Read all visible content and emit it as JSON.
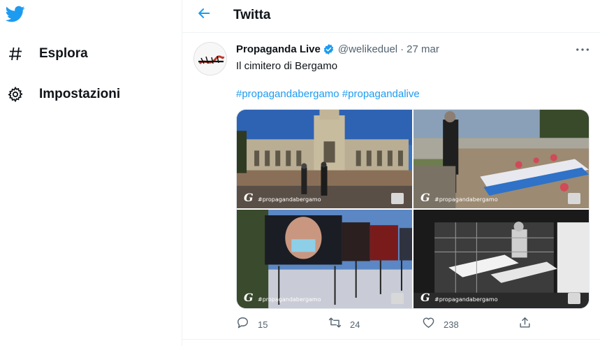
{
  "colors": {
    "accent": "#1d9bf0",
    "text": "#0f1419",
    "muted": "#536471",
    "border": "#eff3f4"
  },
  "sidebar": {
    "logo_icon": "twitter-bird-icon",
    "items": [
      {
        "label": "Esplora",
        "icon": "hashtag-icon"
      },
      {
        "label": "Impostazioni",
        "icon": "gear-icon"
      }
    ]
  },
  "header": {
    "title": "Twitta",
    "back_icon": "arrow-left-icon"
  },
  "tweet": {
    "author": "Propaganda Live",
    "verified": true,
    "handle": "@welikeduel",
    "separator": "·",
    "date": "27 mar",
    "text": "Il cimitero di Bergamo",
    "hashtags": [
      "#propagandabergamo",
      "#propagandalive"
    ],
    "media": [
      {
        "tag": "#propagandabergamo"
      },
      {
        "tag": "#propagandabergamo"
      },
      {
        "tag": "#propagandabergamo"
      },
      {
        "tag": "#propagandabergamo"
      }
    ],
    "actions": {
      "reply_count": "15",
      "retweet_count": "24",
      "like_count": "238"
    }
  }
}
